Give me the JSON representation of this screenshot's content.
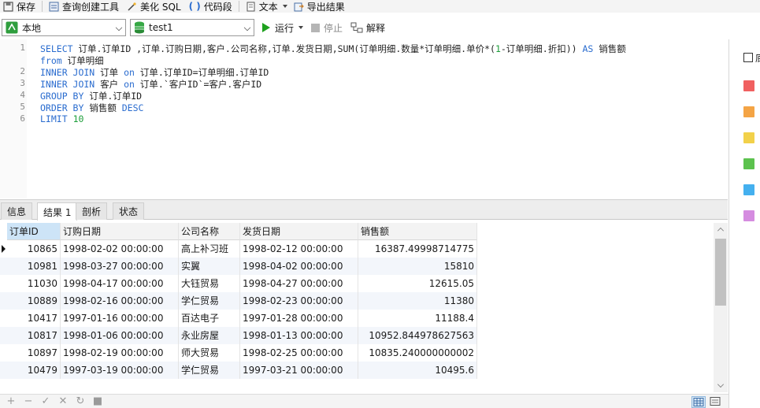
{
  "toolbar": {
    "save": "保存",
    "query_builder": "查询创建工具",
    "beautify": "美化 SQL",
    "snippet": "代码段",
    "text": "文本",
    "export": "导出结果"
  },
  "connection": {
    "connection": "本地",
    "database": "test1",
    "run": "运行",
    "stop": "停止",
    "explain": "解释"
  },
  "editor": {
    "line_numbers": [
      "1",
      "2",
      "3",
      "4",
      "5",
      "6"
    ],
    "lines": [
      [
        {
          "t": "SELECT ",
          "k": true
        },
        {
          "t": "订单.订单ID ,订单.订购日期,客户.公司名称,订单.发货日期,SUM(订单明细.数量*订单明细.单价*("
        },
        {
          "t": "1",
          "n": true
        },
        {
          "t": "-订单明细.折扣)) "
        },
        {
          "t": "AS",
          "k": true
        },
        {
          "t": " 销售额"
        }
      ],
      [
        {
          "t": "from",
          "k": true
        },
        {
          "t": " 订单明细"
        }
      ],
      [
        {
          "t": "INNER JOIN",
          "k": true
        },
        {
          "t": " 订单 "
        },
        {
          "t": "on",
          "k": true
        },
        {
          "t": " 订单.订单ID=订单明细.订单ID"
        }
      ],
      [
        {
          "t": "INNER JOIN",
          "k": true
        },
        {
          "t": " 客户 "
        },
        {
          "t": "on",
          "k": true
        },
        {
          "t": " 订单.`客户ID`=客户.客户ID"
        }
      ],
      [
        {
          "t": "GROUP BY",
          "k": true
        },
        {
          "t": " 订单.订单ID"
        }
      ],
      [
        {
          "t": "ORDER BY",
          "k": true
        },
        {
          "t": " 销售额 "
        },
        {
          "t": "DESC",
          "k": true
        }
      ],
      [
        {
          "t": "LIMIT",
          "k": true
        },
        {
          "t": " "
        },
        {
          "t": "10",
          "n": true
        }
      ]
    ]
  },
  "tabs": [
    "信息",
    "结果 1",
    "剖析",
    "状态"
  ],
  "active_tab": 1,
  "grid": {
    "columns": [
      "订单ID",
      "订购日期",
      "公司名称",
      "发货日期",
      "销售额"
    ],
    "rows": [
      [
        "10865",
        "1998-02-02 00:00:00",
        "高上补习班",
        "1998-02-12 00:00:00",
        "16387.49998714775"
      ],
      [
        "10981",
        "1998-03-27 00:00:00",
        "实翼",
        "1998-04-02 00:00:00",
        "15810"
      ],
      [
        "11030",
        "1998-04-17 00:00:00",
        "大钰贸易",
        "1998-04-27 00:00:00",
        "12615.05"
      ],
      [
        "10889",
        "1998-02-16 00:00:00",
        "学仁贸易",
        "1998-02-23 00:00:00",
        "11380"
      ],
      [
        "10417",
        "1997-01-16 00:00:00",
        "百达电子",
        "1997-01-28 00:00:00",
        "11188.4"
      ],
      [
        "10817",
        "1998-01-06 00:00:00",
        "永业房屋",
        "1998-01-13 00:00:00",
        "10952.844978627563"
      ],
      [
        "10897",
        "1998-02-19 00:00:00",
        "师大贸易",
        "1998-02-25 00:00:00",
        "10835.240000000002"
      ],
      [
        "10479",
        "1997-03-19 00:00:00",
        "学仁贸易",
        "1997-03-21 00:00:00",
        "10495.6"
      ]
    ]
  },
  "right_panel": {
    "label": "底",
    "swatch_colors": [
      "#f06060",
      "#f4a445",
      "#f2d14a",
      "#5cc24e",
      "#44b0ef",
      "#d58ce0"
    ]
  },
  "bottom": {
    "add": "+",
    "remove": "−",
    "apply": "✓",
    "discard": "✕",
    "refresh": "↻",
    "stop": "■"
  }
}
